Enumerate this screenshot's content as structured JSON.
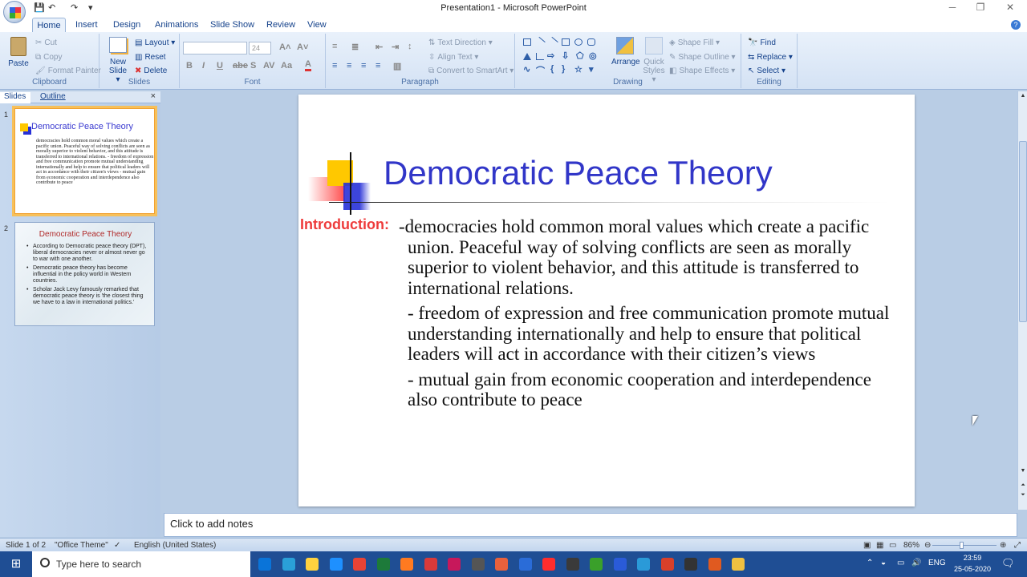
{
  "window": {
    "title": "Presentation1 - Microsoft PowerPoint",
    "controls": {
      "minimize": "─",
      "restore": "❐",
      "close": "✕"
    }
  },
  "quick_access": {
    "save": "💾",
    "undo": "↶",
    "redo": "↷",
    "more": "▾"
  },
  "tabs": [
    "Home",
    "Insert",
    "Design",
    "Animations",
    "Slide Show",
    "Review",
    "View"
  ],
  "ribbon": {
    "clipboard": {
      "label": "Clipboard",
      "paste": "Paste",
      "cut": "Cut",
      "copy": "Copy",
      "format_painter": "Format Painter"
    },
    "slides": {
      "label": "Slides",
      "new_slide": "New",
      "new_slide2": "Slide ▾",
      "layout": "Layout ▾",
      "reset": "Reset",
      "delete": "Delete"
    },
    "font": {
      "label": "Font",
      "font_name": "",
      "font_size": "24"
    },
    "paragraph": {
      "label": "Paragraph",
      "text_direction": "Text Direction ▾",
      "align_text": "Align Text ▾",
      "convert_smartart": "Convert to SmartArt ▾"
    },
    "drawing": {
      "label": "Drawing",
      "arrange": "Arrange",
      "quick_styles": "Quick",
      "quick_styles2": "Styles ▾",
      "shape_fill": "Shape Fill ▾",
      "shape_outline": "Shape Outline ▾",
      "shape_effects": "Shape Effects ▾"
    },
    "editing": {
      "label": "Editing",
      "find": "Find",
      "replace": "Replace ▾",
      "select": "Select ▾"
    }
  },
  "left_pane": {
    "tab_slides": "Slides",
    "tab_outline": "Outline",
    "close": "×",
    "thumb1": {
      "number": "1",
      "title": "Democratic Peace Theory",
      "body": "democracies hold common moral values which create a pacific union. Peaceful way of solving conflicts are seen as morally superior to violent behavior, and this attitude is transferred to international relations. - freedom of expression and free communication promote mutual understanding internationally and help to ensure that political leaders will act in accordance with their citizen's views - mutual gain from economic cooperation and interdependence also contribute to peace"
    },
    "thumb2": {
      "number": "2",
      "title": "Democratic Peace Theory",
      "bullets": [
        "According to Democratic peace theory (DPT), liberal democracies never or almost never go to war with one another.",
        "Democratic peace theory has become influential in the policy world in Western countries.",
        "Scholar Jack Levy famously remarked that democratic peace theory is 'the closest thing we have to a law in international politics.'"
      ]
    }
  },
  "slide": {
    "title": "Democratic Peace Theory",
    "intro_label": "Introduction:",
    "paragraphs": [
      "-democracies hold common moral values which create a pacific union. Peaceful way of solving conflicts are seen as morally superior to violent behavior, and this attitude is transferred to international relations.",
      "- freedom of expression and free communication promote mutual understanding internationally and help to ensure that political leaders will act in accordance with their citizen’s views",
      "- mutual gain from economic cooperation and interdependence also contribute to peace"
    ]
  },
  "notes": {
    "placeholder": "Click to add notes"
  },
  "status": {
    "slide_info": "Slide 1 of 2",
    "theme": "\"Office Theme\"",
    "language": "English (United States)",
    "zoom": "86%"
  },
  "taskbar": {
    "search_placeholder": "Type here to search",
    "language": "ENG",
    "time": "23:59",
    "date": "25-05-2020",
    "app_colors": [
      "#0a74d9",
      "#2aa0d8",
      "#ffd23f",
      "#1e90ff",
      "#e84335",
      "#1d7a3a",
      "#ff7a20",
      "#d93a3a",
      "#c7185b",
      "#555555",
      "#e8613c",
      "#2a6cd8",
      "#ff2d2d",
      "#3a3a3a",
      "#3aa02a",
      "#2a5bd8",
      "#2a9ad8",
      "#d8402a",
      "#333333",
      "#e05a20",
      "#f0c040"
    ]
  }
}
